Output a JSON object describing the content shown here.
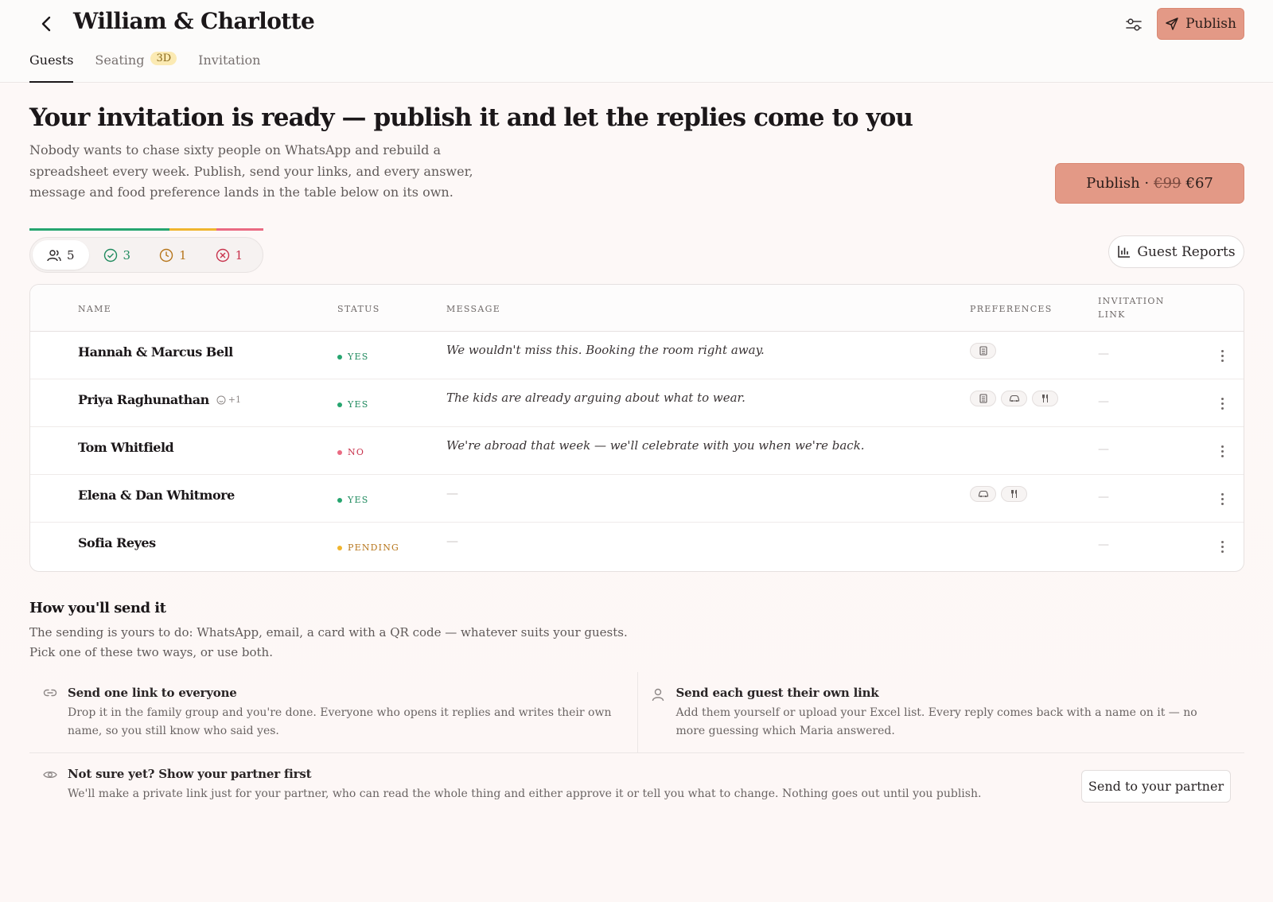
{
  "header": {
    "title": "William & Charlotte",
    "publish_label": "Publish",
    "tabs": [
      {
        "label": "Guests",
        "active": true
      },
      {
        "label": "Seating",
        "badge": "3D"
      },
      {
        "label": "Invitation"
      }
    ]
  },
  "hero": {
    "title": "Your invitation is ready — publish it and let the replies come to you",
    "description": "Nobody wants to chase sixty people on WhatsApp and rebuild a spreadsheet every week. Publish, send your links, and every answer, message and food preference lands in the table below on its own.",
    "publish_label": "Publish ·",
    "old_price": "€99",
    "new_price": "€67"
  },
  "stats": {
    "total": "5",
    "yes": "3",
    "pending": "1",
    "no": "1",
    "progress": {
      "yes_fraction": 0.6,
      "pending_fraction": 0.2,
      "no_fraction": 0.2
    },
    "colors": {
      "yes": "#26a56f",
      "pending": "#f0b52e",
      "no": "#ea6a82"
    }
  },
  "guest_reports_label": "Guest Reports",
  "table": {
    "headers": {
      "name": "NAME",
      "status": "STATUS",
      "message": "MESSAGE",
      "preferences": "PREFERENCES",
      "invitation_line1": "INVITATION",
      "invitation_line2": "LINK"
    },
    "rows": [
      {
        "name": "Hannah & Marcus Bell",
        "status": "YES",
        "message": "We wouldn't miss this. Booking the room right away.",
        "prefs": [
          "hotel-icon"
        ],
        "invitation": "—"
      },
      {
        "name": "Priya Raghunathan",
        "plus": "+1",
        "status": "YES",
        "message": "The kids are already arguing about what to wear.",
        "prefs": [
          "hotel-icon",
          "car-icon",
          "cutlery-icon"
        ],
        "invitation": "—"
      },
      {
        "name": "Tom Whitfield",
        "status": "NO",
        "message": "We're abroad that week — we'll celebrate with you when we're back.",
        "prefs": [],
        "invitation": "—"
      },
      {
        "name": "Elena & Dan Whitmore",
        "status": "YES",
        "message": "—",
        "prefs": [
          "car-icon",
          "cutlery-icon"
        ],
        "invitation": "—"
      },
      {
        "name": "Sofia Reyes",
        "status": "PENDING",
        "message": "—",
        "prefs": [],
        "invitation": "—"
      }
    ]
  },
  "how": {
    "title": "How you'll send it",
    "description": "The sending is yours to do: WhatsApp, email, a card with a QR code — whatever suits your guests. Pick one of these two ways, or use both.",
    "option_one": {
      "title": "Send one link to everyone",
      "description": "Drop it in the family group and you're done. Everyone who opens it replies and writes their own name, so you still know who said yes."
    },
    "option_two": {
      "title": "Send each guest their own link",
      "description": "Add them yourself or upload your Excel list. Every reply comes back with a name on it — no more guessing which Maria answered."
    },
    "partner": {
      "title": "Not sure yet? Show your partner first",
      "description": "We'll make a private link just for your partner, who can read the whole thing and either approve it or tell you what to change. Nothing goes out until you publish.",
      "button": "Send to your partner"
    }
  },
  "colors": {
    "accent": "#e39986",
    "yes": "#1f8a5e",
    "pending": "#b7761c",
    "no": "#c8334d"
  }
}
